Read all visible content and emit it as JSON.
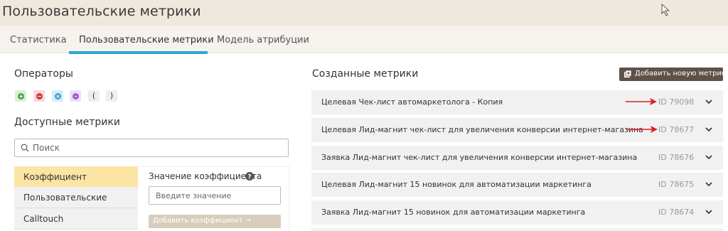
{
  "header": {
    "title": "Пользовательские метрики"
  },
  "tabs": [
    {
      "label": "Статистика",
      "active": false
    },
    {
      "label": "Пользовательские метрики",
      "active": true
    },
    {
      "label": "Модель атрибуции",
      "active": false
    }
  ],
  "left": {
    "operators_title": "Операторы",
    "operators": [
      {
        "name": "plus",
        "bg": "#dcefd6",
        "color": "#3aa84a"
      },
      {
        "name": "minus",
        "bg": "#f6dada",
        "color": "#d23a3a"
      },
      {
        "name": "multiply",
        "bg": "#d8ecf6",
        "color": "#2ca6d6"
      },
      {
        "name": "divide",
        "bg": "#ebe0f5",
        "color": "#a45ad6"
      },
      {
        "name": "open-paren",
        "bg": "#f1ede7",
        "text": "("
      },
      {
        "name": "close-paren",
        "bg": "#f1ede7",
        "text": ")"
      }
    ],
    "available_title": "Доступные метрики",
    "search": {
      "placeholder": "Поиск"
    },
    "categories": [
      {
        "label": "Коэффициент",
        "active": true
      },
      {
        "label": "Пользовательские",
        "active": false
      },
      {
        "label": "Calltouch",
        "active": false
      }
    ],
    "coef": {
      "label": "Значение коэффициента",
      "placeholder": "Введите значение",
      "button": "Добавить коэффициент →"
    }
  },
  "right": {
    "title": "Созданные метрики",
    "add_button": "Добавить новую метрику",
    "metrics": [
      {
        "name": "Целевая Чек-лист автомаркетолога - Копия",
        "id": "ID 79098",
        "arrow": true
      },
      {
        "name": "Целевая Лид-магнит чек-лист для увеличения конверсии интернет-магазина",
        "id": "ID 78677",
        "arrow": true
      },
      {
        "name": "Заявка Лид-магнит чек-лист для увеличения конверсии интернет-магазина",
        "id": "ID 78676",
        "arrow": false
      },
      {
        "name": "Целевая Лид-магнит 15 новинок для автоматизации маркетинга",
        "id": "ID 78675",
        "arrow": false
      },
      {
        "name": "Заявка Лид-магнит 15 новинок для автоматизации маркетинга",
        "id": "ID 78674",
        "arrow": false
      }
    ]
  },
  "colors": {
    "accent": "#2ca6d6",
    "header_bg": "#efe8df",
    "active_category": "#fce4a4",
    "arrow": "#e02020"
  }
}
